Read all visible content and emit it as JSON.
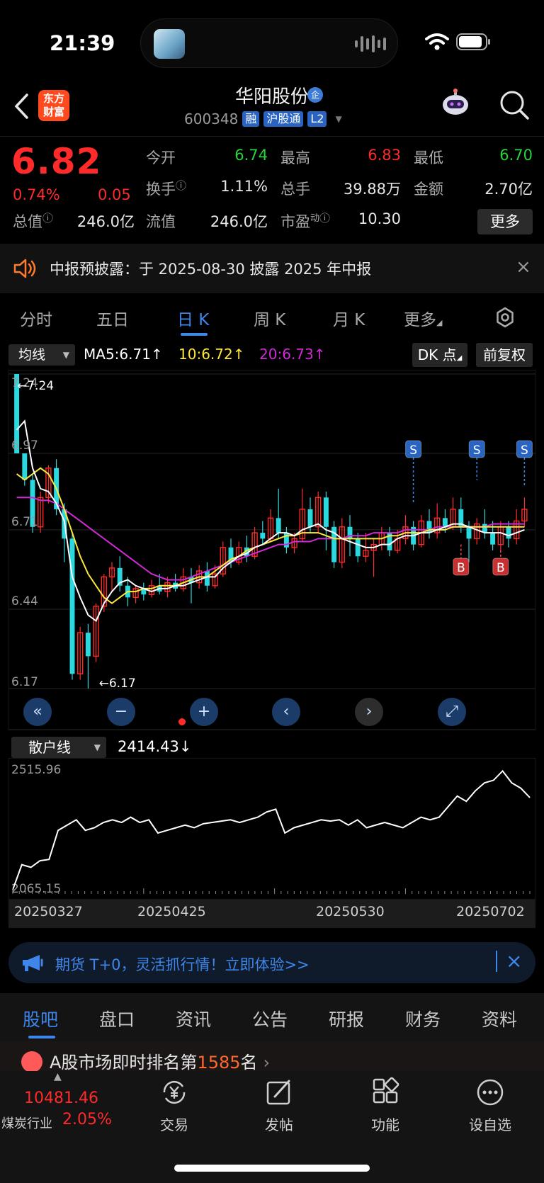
{
  "status": {
    "time": "21:39"
  },
  "header": {
    "logo_line1": "东方",
    "logo_line2": "财富",
    "stock_name": "华阳股份",
    "badge": "企",
    "code": "600348",
    "tags": [
      "融",
      "沪股通",
      "L2"
    ]
  },
  "quote": {
    "price": "6.82",
    "change_pct": "0.74%",
    "change": "0.05",
    "open_label": "今开",
    "open": "6.74",
    "high_label": "最高",
    "high": "6.83",
    "low_label": "最低",
    "low": "6.70",
    "turnover_label": "换手",
    "turnover": "1.11%",
    "volume_label": "总手",
    "volume": "39.88万",
    "amount_label": "金额",
    "amount": "2.70亿",
    "mktcap_label": "总值",
    "mktcap": "246.0亿",
    "float_label": "流值",
    "float": "246.0亿",
    "pe_label": "市盈",
    "pe_sup": "动",
    "pe": "10.30",
    "more": "更多"
  },
  "notice": {
    "text": "中报预披露：于 2025-08-30 披露 2025 年中报"
  },
  "chart_tabs": [
    "分时",
    "五日",
    "日 K",
    "周 K",
    "月 K",
    "更多"
  ],
  "ma_bar": {
    "selector": "均线",
    "ma5": "MA5:6.71",
    "ma10": "10:6.72",
    "ma20": "20:6.73",
    "dk": "DK 点",
    "fq": "前复权"
  },
  "kline": {
    "y_labels": [
      "7.24",
      "6.97",
      "6.71",
      "6.44",
      "6.17"
    ],
    "max_label": "←7.24",
    "min_label": "←6.17",
    "signals": [
      "S",
      "S",
      "S",
      "B",
      "B"
    ]
  },
  "sanhu": {
    "selector": "散户线",
    "value": "2414.43",
    "y_top": "2515.96",
    "y_bottom": "2065.15"
  },
  "dates": [
    "20250327",
    "20250425",
    "20250530",
    "20250702"
  ],
  "ad": {
    "text": "期货 T+0，灵活抓行情！立即体验>>"
  },
  "bottom_tabs": [
    "股吧",
    "盘口",
    "资讯",
    "公告",
    "研报",
    "财务",
    "资料"
  ],
  "news": {
    "prefix": "A股市场即时排名第",
    "rank": "1585",
    "suffix": "名"
  },
  "tabbar": {
    "index_value": "10481.46",
    "industry": "煤炭行业",
    "industry_pct": "2.05%",
    "items": [
      "交易",
      "发帖",
      "功能",
      "设自选"
    ]
  },
  "colors": {
    "up": "#ff2a2a",
    "down": "#2ad8e0",
    "ma5": "#ffffff",
    "ma10": "#ffe83a",
    "ma20": "#d22ad6",
    "accent": "#3e86ea"
  },
  "chart_data": {
    "type": "candlestick",
    "ylim": [
      6.17,
      7.24
    ],
    "candles": [
      [
        7.24,
        6.97,
        7.24,
        6.97
      ],
      [
        6.97,
        6.88,
        6.97,
        6.86
      ],
      [
        6.88,
        6.72,
        6.9,
        6.7
      ],
      [
        6.72,
        6.82,
        6.84,
        6.7
      ],
      [
        6.82,
        6.92,
        6.93,
        6.8
      ],
      [
        6.92,
        6.78,
        6.95,
        6.76
      ],
      [
        6.78,
        6.68,
        6.8,
        6.6
      ],
      [
        6.68,
        6.22,
        6.7,
        6.2
      ],
      [
        6.22,
        6.36,
        6.38,
        6.2
      ],
      [
        6.36,
        6.28,
        6.39,
        6.17
      ],
      [
        6.28,
        6.45,
        6.46,
        6.26
      ],
      [
        6.45,
        6.55,
        6.56,
        6.43
      ],
      [
        6.55,
        6.58,
        6.6,
        6.5
      ],
      [
        6.58,
        6.52,
        6.62,
        6.5
      ],
      [
        6.52,
        6.48,
        6.55,
        6.45
      ],
      [
        6.48,
        6.51,
        6.52,
        6.46
      ],
      [
        6.51,
        6.49,
        6.53,
        6.47
      ],
      [
        6.49,
        6.52,
        6.54,
        6.48
      ],
      [
        6.52,
        6.5,
        6.56,
        6.49
      ],
      [
        6.5,
        6.53,
        6.55,
        6.48
      ],
      [
        6.53,
        6.51,
        6.56,
        6.5
      ],
      [
        6.51,
        6.55,
        6.58,
        6.5
      ],
      [
        6.55,
        6.53,
        6.58,
        6.46
      ],
      [
        6.53,
        6.57,
        6.59,
        6.51
      ],
      [
        6.57,
        6.52,
        6.6,
        6.5
      ],
      [
        6.52,
        6.56,
        6.59,
        6.51
      ],
      [
        6.56,
        6.65,
        6.67,
        6.55
      ],
      [
        6.65,
        6.6,
        6.68,
        6.58
      ],
      [
        6.6,
        6.65,
        6.67,
        6.59
      ],
      [
        6.65,
        6.62,
        6.69,
        6.6
      ],
      [
        6.62,
        6.7,
        6.72,
        6.61
      ],
      [
        6.7,
        6.68,
        6.74,
        6.66
      ],
      [
        6.68,
        6.75,
        6.78,
        6.67
      ],
      [
        6.75,
        6.7,
        6.85,
        6.68
      ],
      [
        6.7,
        6.65,
        6.72,
        6.63
      ],
      [
        6.65,
        6.68,
        6.7,
        6.63
      ],
      [
        6.68,
        6.78,
        6.85,
        6.67
      ],
      [
        6.78,
        6.72,
        6.82,
        6.7
      ],
      [
        6.72,
        6.82,
        6.84,
        6.7
      ],
      [
        6.82,
        6.72,
        6.84,
        6.64
      ],
      [
        6.72,
        6.6,
        6.74,
        6.58
      ],
      [
        6.6,
        6.72,
        6.75,
        6.58
      ],
      [
        6.72,
        6.68,
        6.76,
        6.62
      ],
      [
        6.68,
        6.62,
        6.7,
        6.6
      ],
      [
        6.62,
        6.64,
        6.7,
        6.6
      ],
      [
        6.64,
        6.66,
        6.68,
        6.55
      ],
      [
        6.66,
        6.7,
        6.72,
        6.64
      ],
      [
        6.7,
        6.64,
        6.72,
        6.62
      ],
      [
        6.64,
        6.68,
        6.71,
        6.63
      ],
      [
        6.68,
        6.72,
        6.76,
        6.66
      ],
      [
        6.72,
        6.66,
        6.74,
        6.64
      ],
      [
        6.66,
        6.74,
        6.76,
        6.65
      ],
      [
        6.74,
        6.7,
        6.78,
        6.68
      ],
      [
        6.7,
        6.75,
        6.8,
        6.68
      ],
      [
        6.75,
        6.72,
        6.78,
        6.7
      ],
      [
        6.72,
        6.78,
        6.82,
        6.71
      ],
      [
        6.78,
        6.72,
        6.82,
        6.7
      ],
      [
        6.72,
        6.68,
        6.74,
        6.6
      ],
      [
        6.68,
        6.73,
        6.75,
        6.66
      ],
      [
        6.73,
        6.7,
        6.78,
        6.68
      ],
      [
        6.7,
        6.66,
        6.74,
        6.64
      ],
      [
        6.66,
        6.72,
        6.74,
        6.64
      ],
      [
        6.72,
        6.68,
        6.74,
        6.65
      ],
      [
        6.68,
        6.74,
        6.78,
        6.66
      ],
      [
        6.74,
        6.78,
        6.82,
        6.72
      ]
    ],
    "ma5": [
      7.05,
      7.08,
      6.92,
      6.85,
      6.84,
      6.8,
      6.74,
      6.55,
      6.48,
      6.42,
      6.4,
      6.46,
      6.5,
      6.53,
      6.54,
      6.52,
      6.51,
      6.5,
      6.51,
      6.51,
      6.52,
      6.52,
      6.53,
      6.54,
      6.55,
      6.55,
      6.58,
      6.6,
      6.62,
      6.63,
      6.65,
      6.66,
      6.68,
      6.7,
      6.7,
      6.69,
      6.71,
      6.72,
      6.73,
      6.71,
      6.7,
      6.68,
      6.67,
      6.66,
      6.65,
      6.65,
      6.66,
      6.66,
      6.68,
      6.69,
      6.69,
      6.7,
      6.7,
      6.71,
      6.72,
      6.73,
      6.73,
      6.72,
      6.71,
      6.7,
      6.7,
      6.7,
      6.69,
      6.7,
      6.71
    ],
    "ma10": [
      6.9,
      6.88,
      6.9,
      6.92,
      6.9,
      6.85,
      6.78,
      6.7,
      6.62,
      6.56,
      6.52,
      6.48,
      6.46,
      6.48,
      6.5,
      6.5,
      6.51,
      6.51,
      6.52,
      6.52,
      6.52,
      6.53,
      6.54,
      6.55,
      6.55,
      6.57,
      6.59,
      6.61,
      6.62,
      6.64,
      6.65,
      6.66,
      6.67,
      6.68,
      6.69,
      6.69,
      6.7,
      6.7,
      6.7,
      6.69,
      6.68,
      6.68,
      6.68,
      6.68,
      6.68,
      6.68,
      6.68,
      6.69,
      6.69,
      6.7,
      6.7,
      6.7,
      6.71,
      6.71,
      6.71,
      6.72,
      6.72,
      6.72,
      6.72,
      6.72,
      6.72,
      6.72,
      6.72,
      6.72,
      6.72
    ],
    "ma20": [
      6.82,
      6.82,
      6.82,
      6.81,
      6.81,
      6.8,
      6.78,
      6.76,
      6.74,
      6.72,
      6.7,
      6.68,
      6.66,
      6.64,
      6.62,
      6.6,
      6.58,
      6.56,
      6.55,
      6.54,
      6.54,
      6.54,
      6.55,
      6.56,
      6.57,
      6.58,
      6.59,
      6.6,
      6.61,
      6.62,
      6.63,
      6.64,
      6.65,
      6.66,
      6.66,
      6.67,
      6.67,
      6.67,
      6.68,
      6.68,
      6.68,
      6.68,
      6.69,
      6.69,
      6.69,
      6.7,
      6.7,
      6.7,
      6.7,
      6.71,
      6.71,
      6.71,
      6.71,
      6.72,
      6.72,
      6.72,
      6.72,
      6.72,
      6.72,
      6.72,
      6.73,
      6.73,
      6.73,
      6.73,
      6.73
    ]
  },
  "sanhu_data": [
    2065,
    2160,
    2150,
    2175,
    2180,
    2290,
    2310,
    2330,
    2290,
    2300,
    2320,
    2330,
    2320,
    2340,
    2320,
    2330,
    2280,
    2290,
    2300,
    2310,
    2300,
    2315,
    2320,
    2325,
    2330,
    2320,
    2330,
    2340,
    2360,
    2370,
    2280,
    2300,
    2310,
    2320,
    2330,
    2325,
    2330,
    2310,
    2330,
    2300,
    2310,
    2320,
    2310,
    2300,
    2320,
    2340,
    2330,
    2340,
    2380,
    2420,
    2400,
    2440,
    2470,
    2480,
    2515,
    2470,
    2450,
    2414
  ]
}
